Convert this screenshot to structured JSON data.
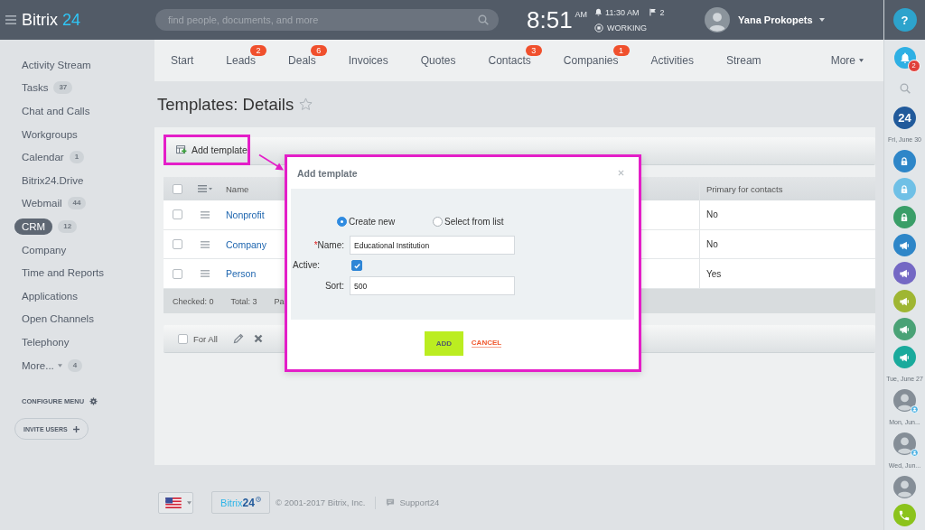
{
  "header": {
    "logo": {
      "name": "Bitrix",
      "number": "24"
    },
    "search": {
      "placeholder": "find people, documents, and more"
    },
    "clock": {
      "time": "8:51",
      "period": "AM"
    },
    "alarm": "11:30 AM",
    "flags": "2",
    "work_status": "WORKING",
    "user": {
      "name": "Yana Prokopets"
    }
  },
  "sidebar": {
    "items": [
      {
        "label": "Activity Stream",
        "kind": "link",
        "selected": false
      },
      {
        "label": "Tasks",
        "kind": "link",
        "counter": "37",
        "selected": false
      },
      {
        "label": "Chat and Calls",
        "kind": "link",
        "selected": false
      },
      {
        "label": "Workgroups",
        "kind": "link",
        "selected": false
      },
      {
        "label": "Calendar",
        "kind": "link",
        "counter": "1",
        "selected": false
      },
      {
        "label": "Bitrix24.Drive",
        "kind": "link",
        "selected": false
      },
      {
        "label": "Webmail",
        "kind": "link",
        "counter": "44",
        "selected": false
      },
      {
        "label": "CRM",
        "kind": "link",
        "counter": "12",
        "selected": true
      },
      {
        "label": "Company",
        "kind": "link",
        "selected": false
      },
      {
        "label": "Time and Reports",
        "kind": "link",
        "selected": false
      },
      {
        "label": "Applications",
        "kind": "link",
        "selected": false
      },
      {
        "label": "Open Channels",
        "kind": "link",
        "selected": false
      },
      {
        "label": "Telephony",
        "kind": "link",
        "selected": false
      },
      {
        "label": "More...",
        "kind": "dropdown",
        "counter": "4",
        "selected": false
      }
    ],
    "configure": "CONFIGURE MENU",
    "invite": "INVITE USERS"
  },
  "tabs": [
    {
      "label": "Start",
      "kind": "link"
    },
    {
      "label": "Leads",
      "kind": "link",
      "badge": "2"
    },
    {
      "label": "Deals",
      "kind": "link",
      "badge": "6"
    },
    {
      "label": "Invoices",
      "kind": "link"
    },
    {
      "label": "Quotes",
      "kind": "link"
    },
    {
      "label": "Contacts",
      "kind": "link",
      "badge": "3"
    },
    {
      "label": "Companies",
      "kind": "link",
      "badge": "1"
    },
    {
      "label": "Activities",
      "kind": "link"
    },
    {
      "label": "Stream",
      "kind": "link"
    },
    {
      "label": "More",
      "kind": "dropdown"
    }
  ],
  "page": {
    "title": "Templates: Details",
    "favorite": false
  },
  "toolbar": {
    "add_button": "Add template",
    "highlighted": true
  },
  "table": {
    "all_checked": false,
    "columns": [
      "Name",
      "Primary for contacts"
    ],
    "rows": [
      {
        "checked": false,
        "name": "Nonprofit",
        "primary": "No"
      },
      {
        "checked": false,
        "name": "Company",
        "primary": "No"
      },
      {
        "checked": false,
        "name": "Person",
        "primary": "Yes"
      }
    ],
    "summary": [
      "Checked: 0",
      "Total: 3",
      "Pa"
    ]
  },
  "actions": {
    "for_all": "For All",
    "checked": false
  },
  "dialog": {
    "title": "Add template",
    "highlighted": true,
    "choices": [
      {
        "label": "Create new",
        "selected": true
      },
      {
        "label": "Select from list",
        "selected": false
      }
    ],
    "fields": [
      {
        "kind": "text",
        "marker": "*",
        "label": "Name:",
        "value": "Educational Institution"
      },
      {
        "kind": "checkbox",
        "label": "Active:",
        "checked": true
      },
      {
        "kind": "text",
        "label": "Sort:",
        "value": "500"
      }
    ],
    "confirm": "ADD",
    "cancel": "CANCEL"
  },
  "right_bar": {
    "help": "?",
    "notifications": "2",
    "items": [
      {
        "kind": "logo",
        "label": "24",
        "color": "#215a9b"
      },
      {
        "kind": "date",
        "label": "Fri, June 30"
      },
      {
        "kind": "lock",
        "color": "#2e86c8"
      },
      {
        "kind": "lock",
        "color": "#6fc0e6"
      },
      {
        "kind": "lock",
        "color": "#3a9e68"
      },
      {
        "kind": "megaphone",
        "color": "#2e86c8"
      },
      {
        "kind": "megaphone",
        "color": "#7468c4"
      },
      {
        "kind": "megaphone",
        "color": "#9fb633"
      },
      {
        "kind": "megaphone",
        "color": "#4aa276"
      },
      {
        "kind": "megaphone",
        "color": "#1aaa9c"
      },
      {
        "kind": "date",
        "label": "Tue, June 27"
      },
      {
        "kind": "avatar",
        "online": true
      },
      {
        "kind": "date",
        "label": "Mon, Jun..."
      },
      {
        "kind": "avatar",
        "online": true
      },
      {
        "kind": "date",
        "label": "Wed, Jun..."
      },
      {
        "kind": "avatar",
        "online": false
      },
      {
        "kind": "phone",
        "color": "#8bc31c"
      }
    ]
  },
  "footer": {
    "logo": {
      "name": "Bitrix",
      "number": "24"
    },
    "copyright": "© 2001-2017 Bitrix, Inc.",
    "support": "Support24"
  }
}
